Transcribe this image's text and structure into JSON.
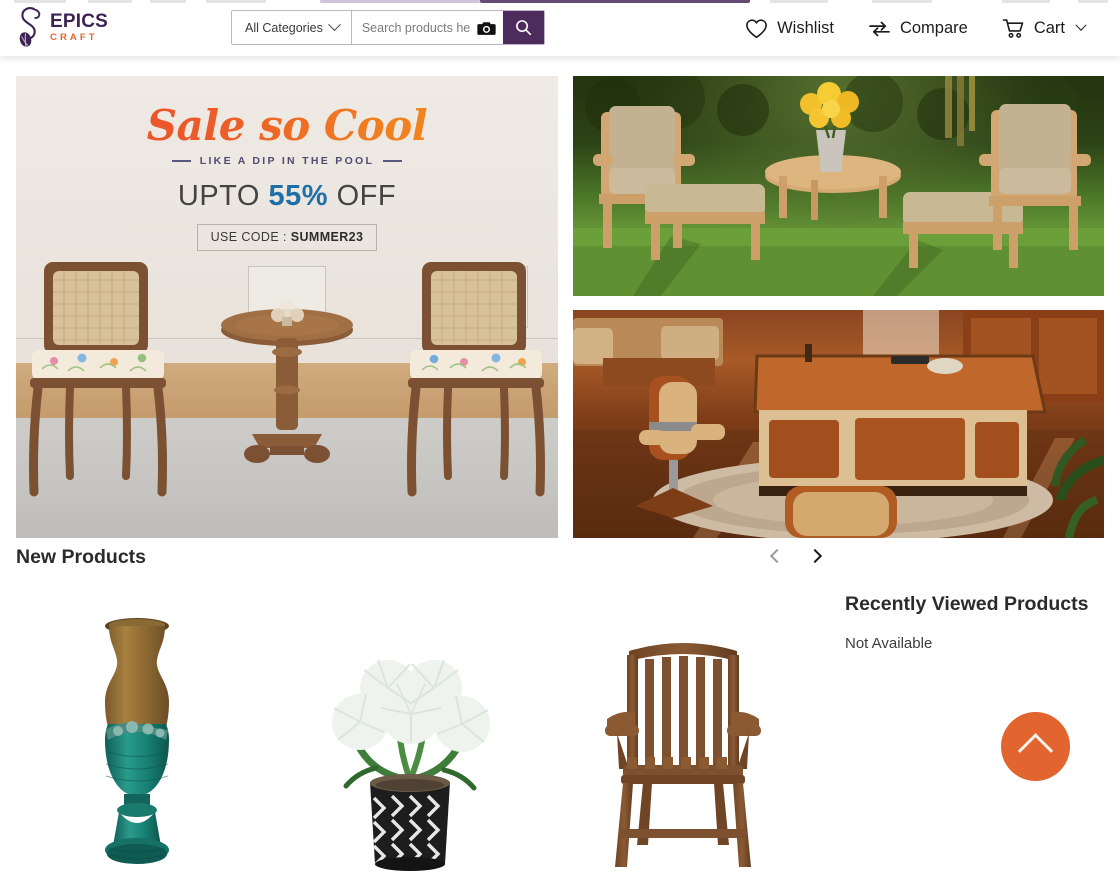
{
  "brand": {
    "name_primary": "EPICS",
    "name_secondary": "CRAFT",
    "mark_icon": "decorative-swirl-icon",
    "color_primary": "#3e2352",
    "color_secondary": "#e2642f"
  },
  "header": {
    "category_select": {
      "label": "All Categories",
      "chevron_icon": "chevron-down-icon"
    },
    "search": {
      "placeholder": "Search products here",
      "value": "",
      "camera_icon": "camera-icon",
      "submit_icon": "search-icon",
      "submit_color": "#4e2b5d"
    },
    "actions": [
      {
        "label": "Wishlist",
        "icon": "heart-icon"
      },
      {
        "label": "Compare",
        "icon": "compare-arrows-icon"
      },
      {
        "label": "Cart",
        "icon": "shopping-cart-icon",
        "chevron_icon": "chevron-down-icon"
      }
    ]
  },
  "hero_banner": {
    "headline": "Sale so Cool",
    "subheadline": "LIKE A DIP IN THE POOL",
    "offer_prefix": "UPTO",
    "offer_value": "55%",
    "offer_suffix": "OFF",
    "code_prefix": "USE CODE :",
    "code_value": "SUMMER23",
    "headline_color": "#ec5a2a",
    "offer_value_color": "#1f6fa8",
    "subheadline_color": "#4e4c74",
    "scene": "two-cane-back-armchairs-and-round-wooden-table"
  },
  "promo_banners": [
    {
      "name": "outdoor-teak-patio-furniture-set-with-yellow-roses"
    },
    {
      "name": "luxury-executive-office-desk-with-leather-chair"
    }
  ],
  "new_products": {
    "title": "New Products",
    "carousel": {
      "prev_icon": "chevron-left-icon",
      "next_icon": "chevron-right-icon",
      "prev_enabled": false,
      "next_enabled": true
    },
    "items": [
      {
        "name": "wooden-teal-carved-floor-vase"
      },
      {
        "name": "white-artificial-flowers-in-chevron-pot"
      },
      {
        "name": "wooden-slatted-folding-garden-armchair"
      }
    ]
  },
  "recently_viewed": {
    "title": "Recently Viewed Products",
    "empty_text": "Not Available"
  },
  "scroll_top": {
    "icon": "chevron-up-icon",
    "color": "#e2642f"
  }
}
